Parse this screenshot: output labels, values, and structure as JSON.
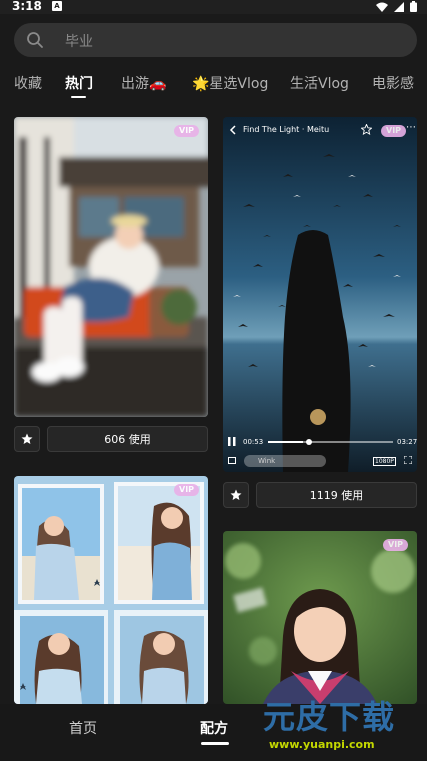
{
  "status": {
    "time": "3:18",
    "a_icon": "A"
  },
  "search": {
    "placeholder": "毕业",
    "icon": "search-icon"
  },
  "tabs": [
    {
      "label": "收藏"
    },
    {
      "label": "热门"
    },
    {
      "label": "出游🚗"
    },
    {
      "label": "🌟星选Vlog"
    },
    {
      "label": "生活Vlog"
    },
    {
      "label": "电影感"
    }
  ],
  "cards": {
    "c1": {
      "vip": "VIP",
      "use_label": "606 使用"
    },
    "c2": {
      "vip": "VIP",
      "song_title": "Find The Light · Meitu",
      "time_start": "00:53",
      "time_end": "03:27",
      "wink": "Wink",
      "quality": "1080P",
      "use_label": "1119 使用"
    },
    "c3": {
      "vip": "VIP"
    },
    "c4": {
      "vip": "VIP"
    }
  },
  "nav": {
    "home": "首页",
    "recipe": "配方"
  },
  "watermark": {
    "logo": "元皮下载",
    "url": "www.yuanpi.com"
  },
  "colors": {
    "background": "#1a1a1a",
    "vip_badge": "#e9b0e8",
    "watermark_blue": "#2e6da6",
    "watermark_yellow": "#c4d800"
  }
}
